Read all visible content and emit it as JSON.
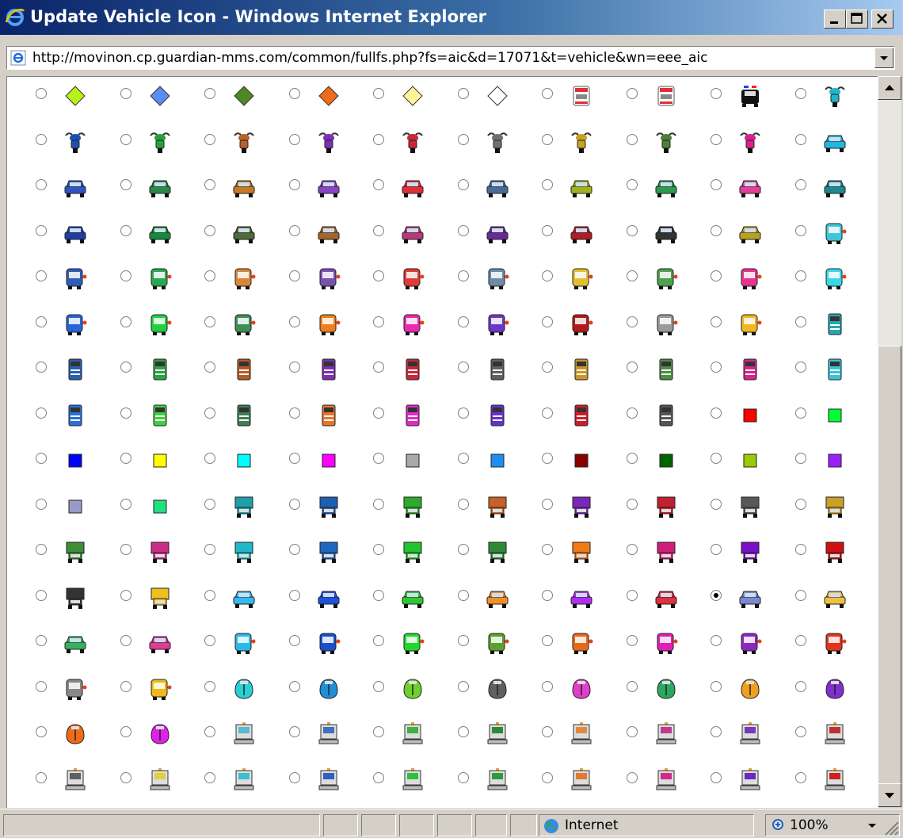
{
  "window": {
    "title": "Update Vehicle Icon - Windows Internet Explorer",
    "url": "http://movinon.cp.guardian-mms.com/common/fullfs.php?fs=aic&d=17071&t=vehicle&wn=eee_aic"
  },
  "status": {
    "zone": "Internet",
    "zoom": "100%"
  },
  "icon_grid": {
    "selected_row": 11,
    "selected_col": 8,
    "rows": [
      [
        {
          "type": "diamond",
          "color": "#b6f21c"
        },
        {
          "type": "diamond",
          "color": "#5b8ef5"
        },
        {
          "type": "diamond",
          "color": "#4e8a24"
        },
        {
          "type": "diamond",
          "color": "#f26a1a"
        },
        {
          "type": "diamond",
          "color": "#fcf39a"
        },
        {
          "type": "diamond",
          "color": "#ffffff"
        },
        {
          "type": "ambulance",
          "color": "#e0303a"
        },
        {
          "type": "ambulance",
          "color": "#e0303a"
        },
        {
          "type": "police",
          "color": "#111111"
        },
        {
          "type": "moto",
          "color": "#20b6c8"
        }
      ],
      [
        {
          "type": "moto",
          "color": "#1e4fb0"
        },
        {
          "type": "moto",
          "color": "#25a03a"
        },
        {
          "type": "moto",
          "color": "#b5622b"
        },
        {
          "type": "moto",
          "color": "#7e2fb8"
        },
        {
          "type": "moto",
          "color": "#c8283a"
        },
        {
          "type": "moto",
          "color": "#707070"
        },
        {
          "type": "moto",
          "color": "#c8a224"
        },
        {
          "type": "moto",
          "color": "#4f7f3a"
        },
        {
          "type": "moto",
          "color": "#d6238f"
        },
        {
          "type": "car",
          "color": "#22b8e0"
        }
      ],
      [
        {
          "type": "car",
          "color": "#2f55c2"
        },
        {
          "type": "car",
          "color": "#2a8a4a"
        },
        {
          "type": "car",
          "color": "#c77a25"
        },
        {
          "type": "car",
          "color": "#8a44c4"
        },
        {
          "type": "car",
          "color": "#e02f35"
        },
        {
          "type": "car",
          "color": "#4a6b98"
        },
        {
          "type": "car",
          "color": "#a2b11e"
        },
        {
          "type": "car",
          "color": "#2e9a50"
        },
        {
          "type": "car",
          "color": "#e33f9a"
        },
        {
          "type": "car",
          "color": "#1c8a8f"
        }
      ],
      [
        {
          "type": "car",
          "color": "#1f3ea5"
        },
        {
          "type": "car",
          "color": "#16883a"
        },
        {
          "type": "car",
          "color": "#4e6b3b"
        },
        {
          "type": "car",
          "color": "#a4662a"
        },
        {
          "type": "car",
          "color": "#b83a7a"
        },
        {
          "type": "car",
          "color": "#6a2a9a"
        },
        {
          "type": "car",
          "color": "#b01c24"
        },
        {
          "type": "car",
          "color": "#333333"
        },
        {
          "type": "car",
          "color": "#b7a21e"
        },
        {
          "type": "bus",
          "color": "#3fc6d8"
        }
      ],
      [
        {
          "type": "bus",
          "color": "#2e5db8"
        },
        {
          "type": "bus",
          "color": "#2ba650"
        },
        {
          "type": "bus",
          "color": "#d9853a"
        },
        {
          "type": "bus",
          "color": "#7a50b0"
        },
        {
          "type": "bus",
          "color": "#e03a3a"
        },
        {
          "type": "bus",
          "color": "#6d8ba5"
        },
        {
          "type": "bus",
          "color": "#e0c030"
        },
        {
          "type": "bus",
          "color": "#4f9f52"
        },
        {
          "type": "bus",
          "color": "#e6348f"
        },
        {
          "type": "bus",
          "color": "#38d8e8"
        }
      ],
      [
        {
          "type": "bus",
          "color": "#2a64d8"
        },
        {
          "type": "bus",
          "color": "#20d040"
        },
        {
          "type": "bus",
          "color": "#3f8e58"
        },
        {
          "type": "bus",
          "color": "#ef7e1e"
        },
        {
          "type": "bus",
          "color": "#e72ab0"
        },
        {
          "type": "bus",
          "color": "#6a38c8"
        },
        {
          "type": "bus",
          "color": "#b01a1a"
        },
        {
          "type": "bus",
          "color": "#9a9a9a"
        },
        {
          "type": "bus",
          "color": "#f1b620"
        },
        {
          "type": "truck",
          "color": "#25a8b2"
        }
      ],
      [
        {
          "type": "truck",
          "color": "#2a5fb0"
        },
        {
          "type": "truck",
          "color": "#2aa440"
        },
        {
          "type": "truck",
          "color": "#b45b2a"
        },
        {
          "type": "truck",
          "color": "#7c30b0"
        },
        {
          "type": "truck",
          "color": "#c82838"
        },
        {
          "type": "truck",
          "color": "#606060"
        },
        {
          "type": "truck",
          "color": "#c8962a"
        },
        {
          "type": "truck",
          "color": "#4e8e44"
        },
        {
          "type": "truck",
          "color": "#d4268a"
        },
        {
          "type": "truck",
          "color": "#38c4d6"
        }
      ],
      [
        {
          "type": "truck",
          "color": "#2a70d6"
        },
        {
          "type": "truck",
          "color": "#3ed040"
        },
        {
          "type": "truck",
          "color": "#3f7e54"
        },
        {
          "type": "truck",
          "color": "#e6752a"
        },
        {
          "type": "truck",
          "color": "#e22ac6"
        },
        {
          "type": "truck",
          "color": "#6432d0"
        },
        {
          "type": "truck",
          "color": "#d01c2a"
        },
        {
          "type": "truck",
          "color": "#555555"
        },
        {
          "type": "square",
          "color": "#ff0000"
        },
        {
          "type": "square",
          "color": "#00ff33"
        }
      ],
      [
        {
          "type": "square",
          "color": "#0000ff"
        },
        {
          "type": "square",
          "color": "#ffff00"
        },
        {
          "type": "square",
          "color": "#00ffff"
        },
        {
          "type": "square",
          "color": "#ff00ff"
        },
        {
          "type": "square",
          "color": "#a8a8a8"
        },
        {
          "type": "square",
          "color": "#1e8ef0"
        },
        {
          "type": "square",
          "color": "#8b0000"
        },
        {
          "type": "square",
          "color": "#006400"
        },
        {
          "type": "square",
          "color": "#99cc00"
        },
        {
          "type": "square",
          "color": "#9b20ff"
        }
      ],
      [
        {
          "type": "square",
          "color": "#9a9ac8"
        },
        {
          "type": "square",
          "color": "#22e080"
        },
        {
          "type": "van",
          "color": "#1ea0a8"
        },
        {
          "type": "van",
          "color": "#1e60b0"
        },
        {
          "type": "van",
          "color": "#2eaa2e"
        },
        {
          "type": "van",
          "color": "#c8602a"
        },
        {
          "type": "van",
          "color": "#7a28b8"
        },
        {
          "type": "van",
          "color": "#c02030"
        },
        {
          "type": "van",
          "color": "#585858"
        },
        {
          "type": "van",
          "color": "#c8a02a"
        }
      ],
      [
        {
          "type": "van",
          "color": "#3f8e3a"
        },
        {
          "type": "van",
          "color": "#c82e8a"
        },
        {
          "type": "boxtruck",
          "color": "#1fb8c8"
        },
        {
          "type": "boxtruck",
          "color": "#1e68c0"
        },
        {
          "type": "boxtruck",
          "color": "#22c430"
        },
        {
          "type": "boxtruck",
          "color": "#2e8a38"
        },
        {
          "type": "boxtruck",
          "color": "#f07a18"
        },
        {
          "type": "boxtruck",
          "color": "#d01e7a"
        },
        {
          "type": "boxtruck",
          "color": "#7810c8"
        },
        {
          "type": "boxtruck",
          "color": "#d01010"
        }
      ],
      [
        {
          "type": "boxtruck",
          "color": "#333333"
        },
        {
          "type": "boxtruck",
          "color": "#f0c020"
        },
        {
          "type": "carsmall",
          "color": "#38b8f0"
        },
        {
          "type": "carsmall",
          "color": "#2050e0"
        },
        {
          "type": "carsmall",
          "color": "#30c830"
        },
        {
          "type": "carsmall",
          "color": "#f0902a"
        },
        {
          "type": "carsmall",
          "color": "#b030f0"
        },
        {
          "type": "carsmall",
          "color": "#e03040"
        },
        {
          "type": "carsmall",
          "color": "#7a8ad0"
        },
        {
          "type": "carsmall",
          "color": "#f0c040"
        }
      ],
      [
        {
          "type": "carsmall",
          "color": "#36b060"
        },
        {
          "type": "carsmall",
          "color": "#e03a9a"
        },
        {
          "type": "coach",
          "color": "#2ab8e8"
        },
        {
          "type": "coach",
          "color": "#1c4fc8"
        },
        {
          "type": "coach",
          "color": "#20d82a"
        },
        {
          "type": "coach",
          "color": "#5aa02a"
        },
        {
          "type": "coach",
          "color": "#e86a18"
        },
        {
          "type": "coach",
          "color": "#e020b0"
        },
        {
          "type": "coach",
          "color": "#8a28c0"
        },
        {
          "type": "coach",
          "color": "#e0341e"
        }
      ],
      [
        {
          "type": "coach",
          "color": "#888888"
        },
        {
          "type": "coach",
          "color": "#f0b818"
        },
        {
          "type": "beetle",
          "color": "#28d0d8"
        },
        {
          "type": "beetle",
          "color": "#1e90d8"
        },
        {
          "type": "beetle",
          "color": "#70d02a"
        },
        {
          "type": "beetle",
          "color": "#606060"
        },
        {
          "type": "beetle",
          "color": "#e040c8"
        },
        {
          "type": "beetle",
          "color": "#2ea860"
        },
        {
          "type": "beetle",
          "color": "#f0a020"
        },
        {
          "type": "beetle",
          "color": "#8030d0"
        }
      ],
      [
        {
          "type": "beetle",
          "color": "#f06a18"
        },
        {
          "type": "beetle",
          "color": "#e020e8"
        },
        {
          "type": "plow",
          "color": "#5ab8d0"
        },
        {
          "type": "plow",
          "color": "#4070c0"
        },
        {
          "type": "plow",
          "color": "#40b040"
        },
        {
          "type": "plow",
          "color": "#2a8a3a"
        },
        {
          "type": "plow",
          "color": "#e08a40"
        },
        {
          "type": "plow",
          "color": "#c03a8a"
        },
        {
          "type": "plow",
          "color": "#7a3ab8"
        },
        {
          "type": "plow",
          "color": "#c03030"
        }
      ],
      [
        {
          "type": "plow",
          "color": "#606060"
        },
        {
          "type": "plow",
          "color": "#e0d040"
        },
        {
          "type": "plow",
          "color": "#38c0d0"
        },
        {
          "type": "plow",
          "color": "#2e60c0"
        },
        {
          "type": "plow",
          "color": "#30c040"
        },
        {
          "type": "plow",
          "color": "#2e9a40"
        },
        {
          "type": "plow",
          "color": "#e07a30"
        },
        {
          "type": "plow",
          "color": "#d02a8a"
        },
        {
          "type": "plow",
          "color": "#6a28c0"
        },
        {
          "type": "plow",
          "color": "#d02020"
        }
      ],
      [
        {
          "type": "plow",
          "color": "#888888"
        },
        {
          "type": "plow",
          "color": "#888888"
        },
        {
          "type": "plow",
          "color": "#888888"
        },
        {
          "type": "plow",
          "color": "#888888"
        },
        {
          "type": "plow",
          "color": "#888888"
        },
        {
          "type": "plow",
          "color": "#888888"
        },
        {
          "type": "plow",
          "color": "#888888"
        },
        {
          "type": "plow",
          "color": "#888888"
        },
        {
          "type": "plow",
          "color": "#888888"
        },
        {
          "type": "plow",
          "color": "#888888"
        }
      ]
    ]
  }
}
